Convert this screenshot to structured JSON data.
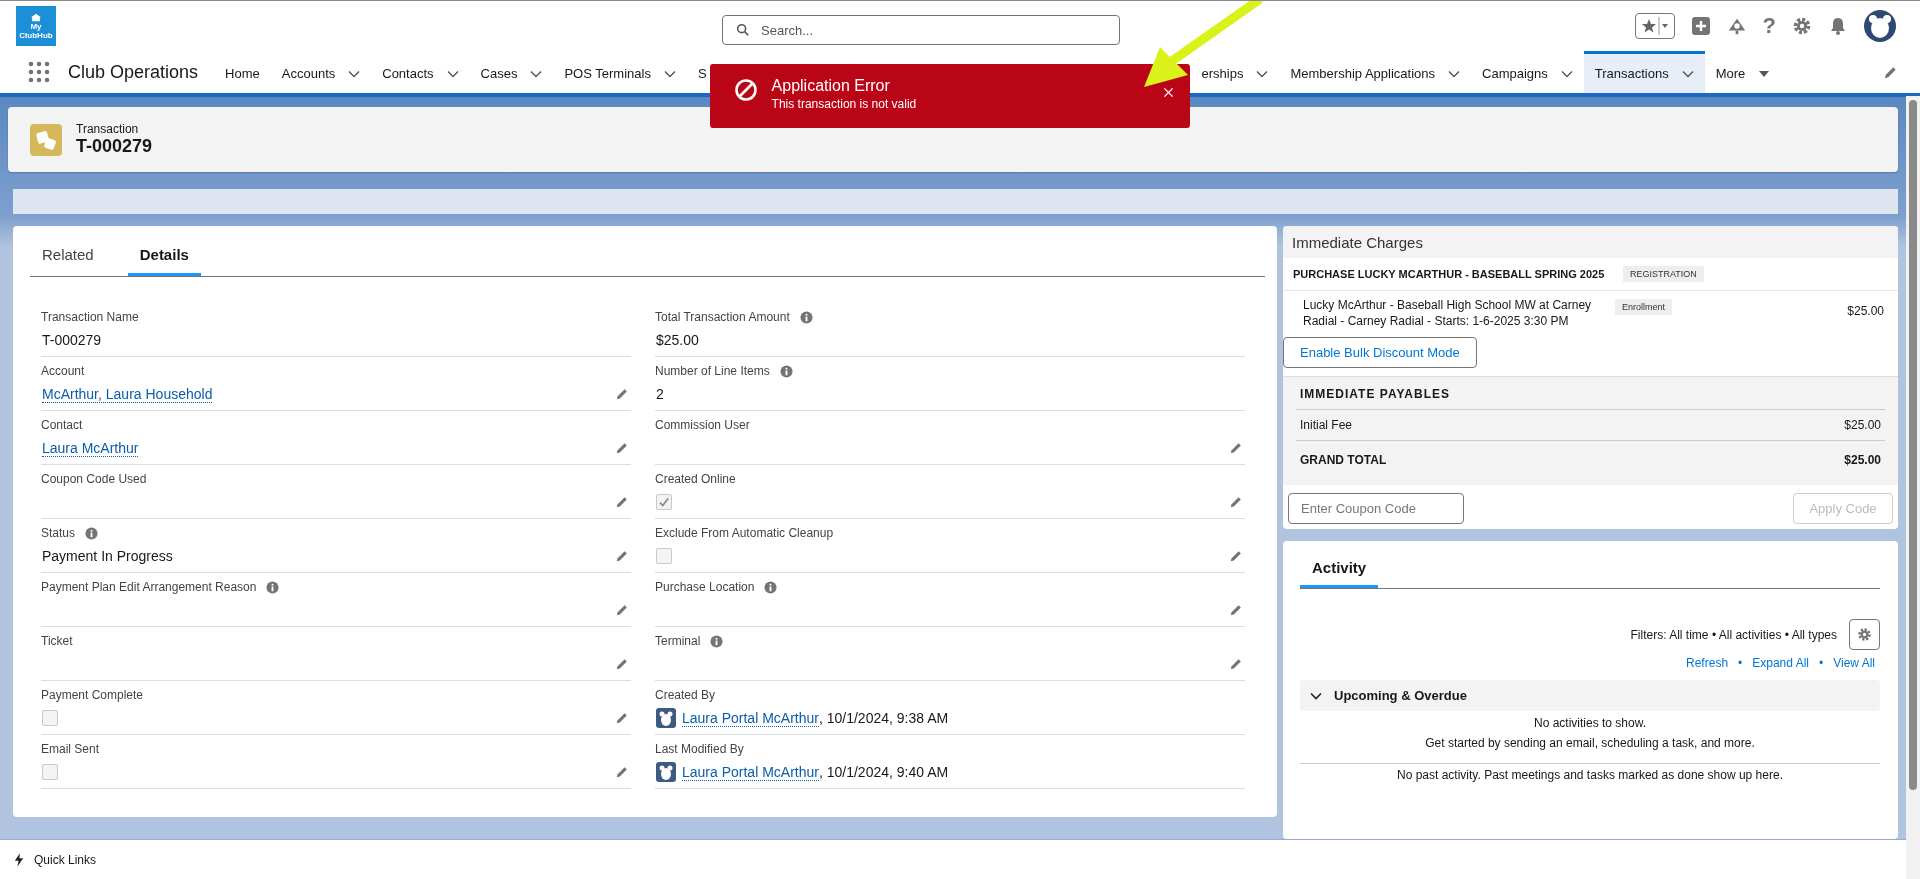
{
  "app": {
    "logo_text": "My ClubHub",
    "name": "Club Operations"
  },
  "search": {
    "placeholder": "Search..."
  },
  "help_glyph": "?",
  "nav": [
    {
      "label": "Home",
      "kind": "link",
      "selected": false
    },
    {
      "label": "Accounts",
      "kind": "menu",
      "selected": false
    },
    {
      "label": "Contacts",
      "kind": "menu",
      "selected": false
    },
    {
      "label": "Cases",
      "kind": "menu",
      "selected": false
    },
    {
      "label": "POS Terminals",
      "kind": "menu",
      "selected": false
    },
    {
      "label": "S",
      "kind": "link",
      "selected": false,
      "covered": true
    },
    {
      "label": "erships",
      "kind": "menu",
      "selected": false
    },
    {
      "label": "Membership Applications",
      "kind": "menu",
      "selected": false
    },
    {
      "label": "Campaigns",
      "kind": "menu",
      "selected": false
    },
    {
      "label": "Transactions",
      "kind": "menu",
      "selected": true
    },
    {
      "label": "More",
      "kind": "more",
      "selected": false
    }
  ],
  "toast": {
    "title": "Application Error",
    "message": "This transaction is not valid"
  },
  "record": {
    "type": "Transaction",
    "name": "T-000279"
  },
  "tabs": [
    {
      "label": "Related",
      "selected": false
    },
    {
      "label": "Details",
      "selected": true
    }
  ],
  "details": {
    "left": [
      {
        "label": "Transaction Name",
        "kind": "text",
        "value": "T-000279",
        "info": false,
        "editable": false
      },
      {
        "label": "Account",
        "kind": "link",
        "value": "McArthur, Laura Household",
        "info": false,
        "editable": true
      },
      {
        "label": "Contact",
        "kind": "link",
        "value": "Laura McArthur",
        "info": false,
        "editable": true
      },
      {
        "label": "Coupon Code Used",
        "kind": "empty",
        "info": false,
        "editable": true
      },
      {
        "label": "Status",
        "kind": "text",
        "value": "Payment In Progress",
        "info": true,
        "editable": true
      },
      {
        "label": "Payment Plan Edit Arrangement Reason",
        "kind": "empty",
        "info": true,
        "editable": true
      },
      {
        "label": "Ticket",
        "kind": "empty",
        "info": false,
        "editable": true
      },
      {
        "label": "Payment Complete",
        "kind": "checkbox",
        "checked": false,
        "info": false,
        "editable": true
      },
      {
        "label": "Email Sent",
        "kind": "checkbox",
        "checked": false,
        "info": false,
        "editable": true
      }
    ],
    "right": [
      {
        "label": "Total Transaction Amount",
        "kind": "text",
        "value": "$25.00",
        "info": true,
        "editable": false
      },
      {
        "label": "Number of Line Items",
        "kind": "text",
        "value": "2",
        "info": true,
        "editable": false
      },
      {
        "label": "Commission User",
        "kind": "empty",
        "info": false,
        "editable": true
      },
      {
        "label": "Created Online",
        "kind": "checkbox",
        "checked": true,
        "info": false,
        "editable": true
      },
      {
        "label": "Exclude From Automatic Cleanup",
        "kind": "checkbox",
        "checked": false,
        "info": false,
        "editable": true
      },
      {
        "label": "Purchase Location",
        "kind": "empty",
        "info": true,
        "editable": true
      },
      {
        "label": "Terminal",
        "kind": "empty",
        "info": true,
        "editable": true
      },
      {
        "label": "Created By",
        "kind": "user",
        "value": "Laura Portal McArthur",
        "suffix": ", 10/1/2024, 9:38 AM",
        "info": false,
        "editable": false
      },
      {
        "label": "Last Modified By",
        "kind": "user",
        "value": "Laura Portal McArthur",
        "suffix": ", 10/1/2024, 9:40 AM",
        "info": false,
        "editable": false
      }
    ]
  },
  "charges": {
    "title": "Immediate Charges",
    "group": {
      "title": "PURCHASE LUCKY MCARTHUR - BASEBALL SPRING 2025",
      "tag": "REGISTRATION"
    },
    "items": [
      {
        "description": "Lucky McArthur - Baseball High School MW at Carney Radial - Carney Radial - Starts: 1-6-2025 3:30 PM",
        "tag": "Enrollment",
        "amount": "$25.00"
      }
    ],
    "bulk_button": "Enable Bulk Discount Mode",
    "payables": {
      "title": "IMMEDIATE PAYABLES",
      "rows": [
        {
          "label": "Initial Fee",
          "amount": "$25.00"
        }
      ],
      "total": {
        "label": "GRAND TOTAL",
        "amount": "$25.00"
      }
    },
    "coupon": {
      "placeholder": "Enter Coupon Code",
      "button": "Apply Code",
      "disabled": true
    }
  },
  "activity": {
    "tab": "Activity",
    "filters": "Filters: All time • All activities • All types",
    "separator": "•",
    "links": [
      "Refresh",
      "Expand All",
      "View All"
    ],
    "section": {
      "title": "Upcoming & Overdue",
      "expanded": true
    },
    "empty": [
      "No activities to show.",
      "Get started by sending an email, scheduling a task, and more."
    ],
    "past": "No past activity. Past meetings and tasks marked as done show up here."
  },
  "footer": {
    "label": "Quick Links"
  }
}
